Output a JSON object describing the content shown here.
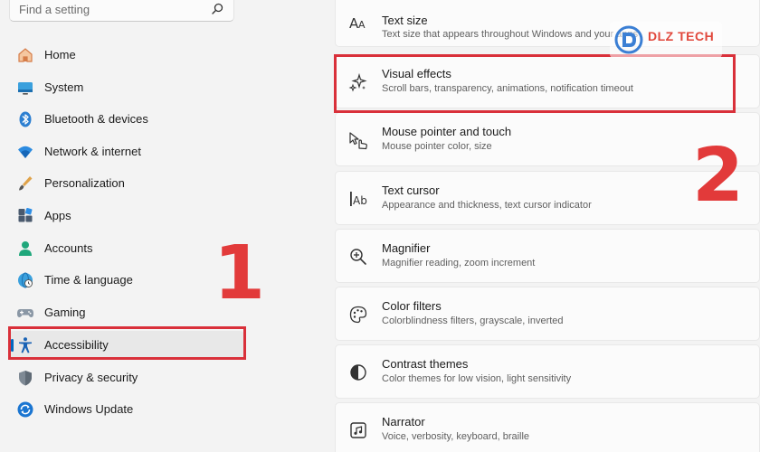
{
  "search": {
    "placeholder": "Find a setting",
    "icon": "search-icon"
  },
  "sidebar": {
    "items": [
      {
        "label": "Home",
        "icon": "home-icon"
      },
      {
        "label": "System",
        "icon": "system-icon"
      },
      {
        "label": "Bluetooth & devices",
        "icon": "bluetooth-icon"
      },
      {
        "label": "Network & internet",
        "icon": "wifi-icon"
      },
      {
        "label": "Personalization",
        "icon": "brush-icon"
      },
      {
        "label": "Apps",
        "icon": "apps-icon"
      },
      {
        "label": "Accounts",
        "icon": "person-icon"
      },
      {
        "label": "Time & language",
        "icon": "globe-clock-icon"
      },
      {
        "label": "Gaming",
        "icon": "gamepad-icon"
      },
      {
        "label": "Accessibility",
        "icon": "accessibility-icon",
        "selected": true
      },
      {
        "label": "Privacy & security",
        "icon": "shield-icon"
      },
      {
        "label": "Windows Update",
        "icon": "update-icon"
      }
    ]
  },
  "main": {
    "items": [
      {
        "title": "Text size",
        "subtitle": "Text size that appears throughout Windows and your apps",
        "icon": "text-size-icon"
      },
      {
        "title": "Visual effects",
        "subtitle": "Scroll bars, transparency, animations, notification timeout",
        "icon": "sparkle-icon"
      },
      {
        "title": "Mouse pointer and touch",
        "subtitle": "Mouse pointer color, size",
        "icon": "pointer-hand-icon"
      },
      {
        "title": "Text cursor",
        "subtitle": "Appearance and thickness, text cursor indicator",
        "icon": "text-cursor-icon"
      },
      {
        "title": "Magnifier",
        "subtitle": "Magnifier reading, zoom increment",
        "icon": "magnifier-icon"
      },
      {
        "title": "Color filters",
        "subtitle": "Colorblindness filters, grayscale, inverted",
        "icon": "palette-icon"
      },
      {
        "title": "Contrast themes",
        "subtitle": "Color themes for low vision, light sensitivity",
        "icon": "contrast-icon"
      },
      {
        "title": "Narrator",
        "subtitle": "Voice, verbosity, keyboard, braille",
        "icon": "narrator-icon"
      }
    ]
  },
  "annotations": {
    "step1": "1",
    "step2": "2",
    "color": "#e23a3a"
  },
  "watermark": {
    "text": "DLZ TECH"
  },
  "colors": {
    "accent": "#0067c0",
    "highlight_box": "#d9303a"
  }
}
